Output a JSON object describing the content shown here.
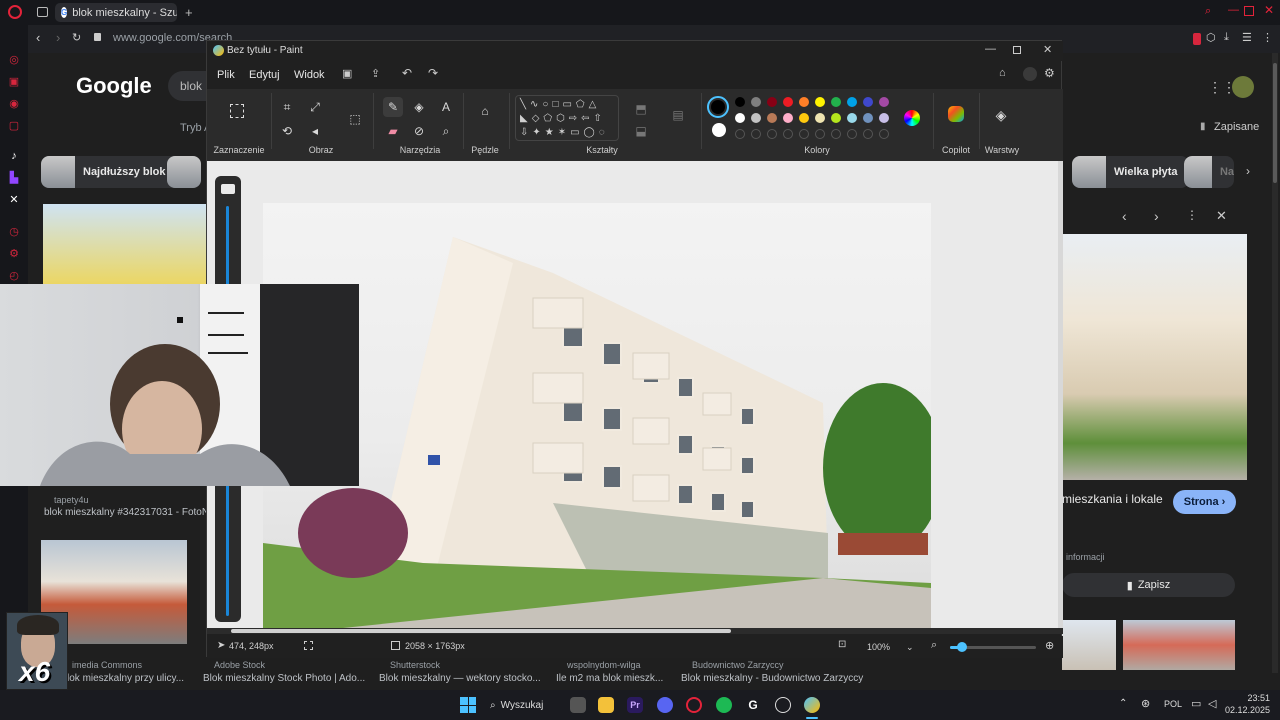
{
  "browser": {
    "tab_title": "blok mieszkalny - Szukaj",
    "url": "www.google.com/search"
  },
  "google": {
    "logo": "Google",
    "query": "blok",
    "tryb_label": "Tryb A",
    "zapisane": "Zapisane",
    "chips": [
      "Najdłuższy blok",
      "Wielka płyta",
      "Na"
    ],
    "result1_source": "tapety4u",
    "result1_title": "blok mieszkalny #342317031 - FotoNa",
    "preview_info_title": "mieszkania i lokale",
    "preview_strona": "Strona",
    "preview_informacji": "informacji",
    "preview_zapisz": "Zapisz",
    "bottom_sources": [
      "imedia Commons",
      "Adobe Stock",
      "Shutterstock",
      "wspolnydom-wilga",
      "Budownictwo Zarzyccy"
    ],
    "bottom_titles": [
      "e:Blok mieszkalny przy ulicy...",
      "Blok mieszkalny Stock Photo | Ado...",
      "Blok mieszkalny — wektory stocko...",
      "Ile m2 ma blok mieszk...",
      "Blok mieszkalny - Budownictwo Zarzyccy"
    ]
  },
  "paint": {
    "title": "Bez tytułu - Paint",
    "menu": [
      "Plik",
      "Edytuj",
      "Widok"
    ],
    "groups": {
      "zaznaczenie": "Zaznaczenie",
      "obraz": "Obraz",
      "narzedzia": "Narzędzia",
      "pedzle": "Pędzle",
      "ksztalty": "Kształty",
      "kolory": "Kolory",
      "copilot": "Copilot",
      "warstwy": "Warstwy"
    },
    "colors_row1": [
      "#000000",
      "#7f7f7f",
      "#880015",
      "#ed1c24",
      "#ff7f27",
      "#fff200",
      "#22b14c",
      "#00a2e8",
      "#3f48cc",
      "#a349a4"
    ],
    "colors_row2": [
      "#ffffff",
      "#c3c3c3",
      "#b97a57",
      "#ffaec9",
      "#ffc90e",
      "#efe4b0",
      "#b5e61d",
      "#99d9ea",
      "#7092be",
      "#c8bfe7"
    ],
    "status": {
      "cursor": "474, 248px",
      "image_size": "2058 × 1763px",
      "zoom": "100%"
    },
    "zoom_level": 0.14
  },
  "overlay": {
    "multiplier": "x6"
  },
  "taskbar": {
    "search": "Wyszukaj",
    "lang": "POL",
    "time": "23:51",
    "date": "02.12.2025"
  }
}
